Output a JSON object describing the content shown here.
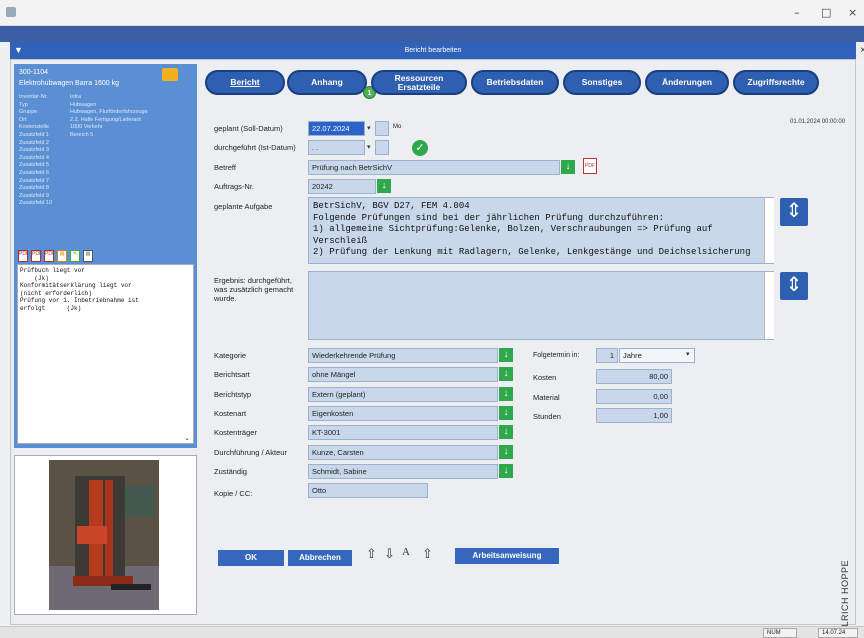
{
  "window": {
    "minimize": "–",
    "maximize": "□",
    "close": "×"
  },
  "dialog": {
    "title": "Bericht bearbeiten",
    "close": "×"
  },
  "sidebar": {
    "id": "300-1104",
    "name": "Elektrohubwagen Barra 1600 kg",
    "fields": [
      {
        "k": "Inventar-Nr.",
        "v": "Infra"
      },
      {
        "k": "Typ",
        "v": "Hubwagen"
      },
      {
        "k": "Gruppe",
        "v": "Hubwagen, Flurförderfahrzeuge"
      },
      {
        "k": "Ort",
        "v": "2.2. Halle Fertigung/Lieferant"
      },
      {
        "k": "Kostenstelle",
        "v": "1000 Verkehr"
      },
      {
        "k": "Zusatzfeld 1",
        "v": "Bereich 5"
      },
      {
        "k": "Zusatzfeld 2",
        "v": ""
      },
      {
        "k": "Zusatzfeld 3",
        "v": ""
      },
      {
        "k": "Zusatzfeld 4",
        "v": ""
      },
      {
        "k": "Zusatzfeld 5",
        "v": ""
      },
      {
        "k": "Zusatzfeld 6",
        "v": ""
      },
      {
        "k": "Zusatzfeld 7",
        "v": ""
      },
      {
        "k": "Zusatzfeld 8",
        "v": ""
      },
      {
        "k": "Zusatzfeld 9",
        "v": ""
      },
      {
        "k": "Zusatzfeld 10",
        "v": ""
      }
    ],
    "notes": "Prüfbuch liegt vor\n    (Jk)\nKonformitätserklärung liegt vor\n(nicht erforderlich)\nPrüfung vor 1. Inbetriebnahme ist\nerfolgt      (Jk)"
  },
  "tabs": [
    {
      "label": "Bericht"
    },
    {
      "label": "Anhang",
      "badge": "1"
    },
    {
      "label": "Ressourcen\nErsatzteile"
    },
    {
      "label": "Betriebsdaten"
    },
    {
      "label": "Sonstiges"
    },
    {
      "label": "Änderungen"
    },
    {
      "label": "Zugriffsrechte"
    }
  ],
  "timestamp": "01.01.2024 00:00:00",
  "form": {
    "geplant_label": "geplant (Soll-Datum)",
    "geplant_value": "22.07.2024",
    "geplant_day": "Mo",
    "durchgefuehrt_label": "durchgeführt (Ist-Datum)",
    "durchgefuehrt_value": ". .",
    "betreff_label": "Betreff",
    "betreff_value": "Prüfung nach BetrSichV",
    "auftrag_label": "Auftrags-Nr.",
    "auftrag_value": "20242",
    "aufgabe_label": "geplante Aufgabe",
    "aufgabe_value": "BetrSichV, BGV D27, FEM 4.004\nFolgende Prüfungen sind bei der jährlichen Prüfung durchzuführen:\n1) allgemeine Sichtprüfung:Gelenke, Bolzen, Verschraubungen => Prüfung auf Verschleiß\n2) Prüfung der Lenkung mit Radlagern, Gelenke, Lenkgestänge und Deichselsicherung",
    "ergebnis_label": "Ergebnis: durchgeführt, was zusätzlich gemacht wurde.",
    "ergebnis_value": "",
    "kategorie_label": "Kategorie",
    "kategorie_value": "Wiederkehrende Prüfung",
    "berichtsart_label": "Berichtsart",
    "berichtsart_value": "ohne Mängel",
    "berichtstyp_label": "Berichtstyp",
    "berichtstyp_value": "Extern (geplant)",
    "kostenart_label": "Kostenart",
    "kostenart_value": "Eigenkosten",
    "kostentraeger_label": "Kostenträger",
    "kostentraeger_value": "KT-3001",
    "durchfuehrung_label": "Durchführung / Akteur",
    "durchfuehrung_value": "Kunze, Carsten",
    "zustaendig_label": "Zuständig",
    "zustaendig_value": "Schmidt, Sabine",
    "kopie_label": "Kopie / CC:",
    "kopie_value": "Otto",
    "folgetermin_label": "Folgetermin in:",
    "folgetermin_num": "1",
    "folgetermin_unit": "Jahre",
    "kosten_label": "Kosten",
    "kosten_value": "80,00",
    "material_label": "Material",
    "material_value": "0,00",
    "stunden_label": "Stunden",
    "stunden_value": "1,00"
  },
  "buttons": {
    "ok": "OK",
    "abbrechen": "Abbrechen",
    "arbeitsanweisung": "Arbeitsanweisung"
  },
  "watermark": "ULRICH HOPPE",
  "status": {
    "num": "NUM",
    "time": "14.07.24"
  },
  "colors": {
    "accent": "#2e5fb0",
    "field": "#c9d7ea",
    "ok_green": "#2ea84a"
  }
}
